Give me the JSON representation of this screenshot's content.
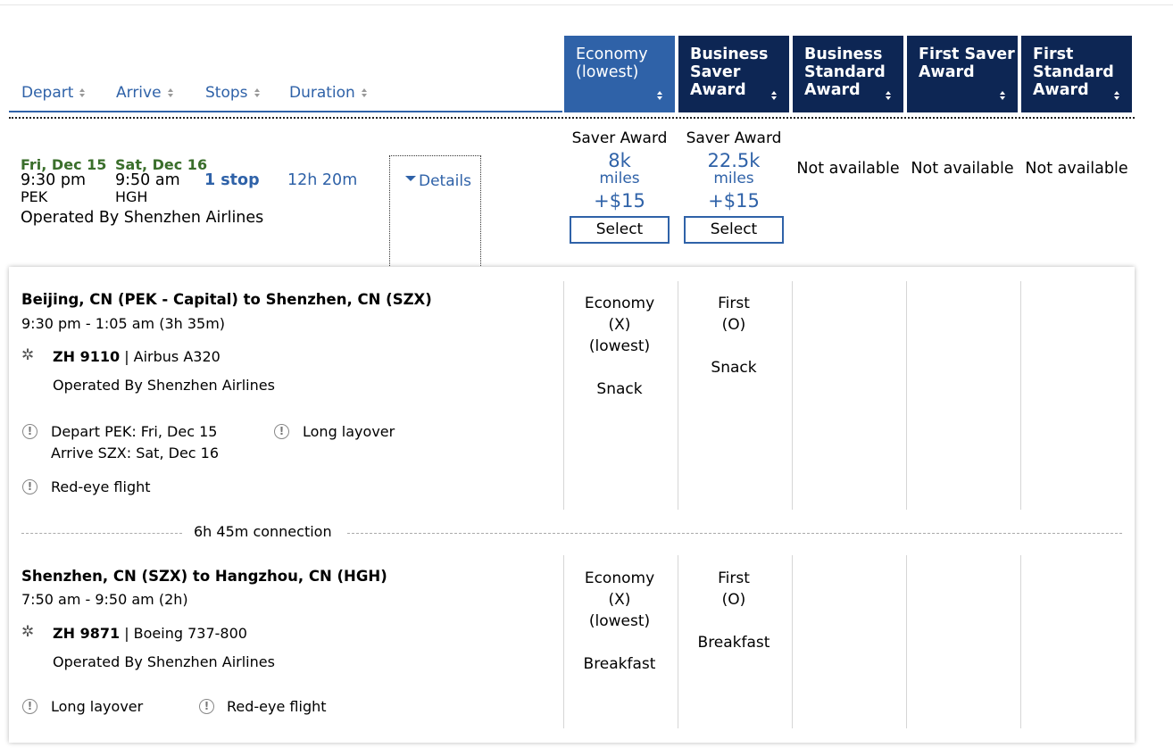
{
  "sort_headers": {
    "depart": "Depart",
    "arrive": "Arrive",
    "stops": "Stops",
    "duration": "Duration"
  },
  "fare_columns": [
    {
      "line1": "Economy",
      "line2": "(lowest)",
      "line3": ""
    },
    {
      "line1": "Business",
      "line2": "Saver",
      "line3": "Award"
    },
    {
      "line1": "Business",
      "line2": "Standard",
      "line3": "Award"
    },
    {
      "line1": "First Saver",
      "line2": "Award",
      "line3": ""
    },
    {
      "line1": "First",
      "line2": "Standard",
      "line3": "Award"
    }
  ],
  "flight": {
    "depart_date": "Fri, Dec 15",
    "depart_time": "9:30 pm",
    "depart_airport": "PEK",
    "arrive_date": "Sat, Dec 16",
    "arrive_time": "9:50 am",
    "arrive_airport": "HGH",
    "stops": "1 stop",
    "duration": "12h 20m",
    "operated_by": "Operated By Shenzhen Airlines",
    "details_label": "Details"
  },
  "fares": [
    {
      "label": "Saver Award",
      "miles": "8k",
      "unit": "miles",
      "tax": "+$15",
      "button": "Select"
    },
    {
      "label": "Saver Award",
      "miles": "22.5k",
      "unit": "miles",
      "tax": "+$15",
      "button": "Select"
    }
  ],
  "not_available": "Not available",
  "segments": [
    {
      "title": "Beijing, CN (PEK - Capital) to Shenzhen, CN (SZX)",
      "times": "9:30 pm - 1:05 am (3h 35m)",
      "flight_no": "ZH 9110",
      "aircraft": "| Airbus A320",
      "operated_by": "Operated By Shenzhen Airlines",
      "notice_depart": "Depart PEK: Fri, Dec 15",
      "notice_arrive": "Arrive SZX: Sat, Dec 16",
      "notice_layover": "Long layover",
      "notice_redeye": "Red-eye flight",
      "cabin_econ": [
        "Economy",
        "(X)",
        "(lowest)",
        "",
        "Snack"
      ],
      "cabin_first": [
        "First",
        "(O)",
        "",
        "Snack"
      ]
    },
    {
      "title": "Shenzhen, CN (SZX) to Hangzhou, CN (HGH)",
      "times": "7:50 am - 9:50 am (2h)",
      "flight_no": "ZH 9871",
      "aircraft": "| Boeing 737-800",
      "operated_by": "Operated By Shenzhen Airlines",
      "notice_layover": "Long layover",
      "notice_redeye": "Red-eye flight",
      "cabin_econ": [
        "Economy",
        "(X)",
        "(lowest)",
        "",
        "Breakfast"
      ],
      "cabin_first": [
        "First",
        "(O)",
        "",
        "Breakfast"
      ]
    }
  ],
  "connection": "6h 45m connection",
  "colors": {
    "accent": "#2f62a8",
    "header_dark": "#0d2654",
    "date_green": "#3a6e2b"
  },
  "icons": {
    "sort": "sort-arrows-icon",
    "notice": "exclamation-circle-icon",
    "airline": "airline-star-icon",
    "expand": "caret-down-icon"
  }
}
